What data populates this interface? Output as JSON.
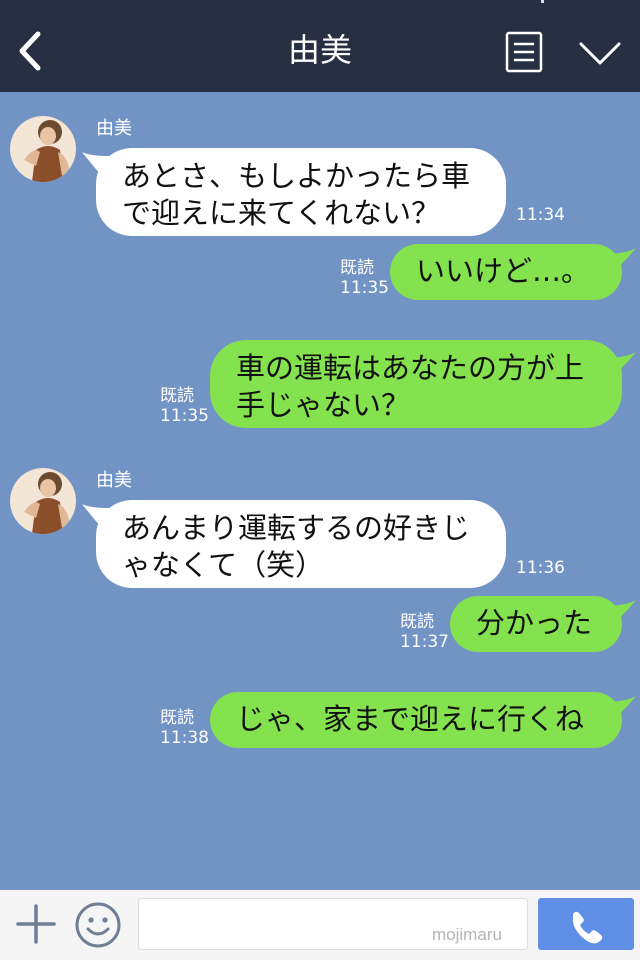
{
  "header": {
    "contact_name": "由美",
    "back_icon": "chevron-left-icon",
    "menu_icon": "list-icon",
    "collapse_icon": "chevron-down-icon"
  },
  "messages": [
    {
      "direction": "in",
      "sender": "由美",
      "lines": [
        "あとさ、もしよかったら車",
        "で迎えに来てくれない？"
      ],
      "time": "11:34"
    },
    {
      "direction": "out",
      "read_label": "既読",
      "lines": [
        "いいけど…。"
      ],
      "time": "11:35"
    },
    {
      "direction": "out",
      "read_label": "既読",
      "lines": [
        "車の運転はあなたの方が上",
        "手じゃない？"
      ],
      "time": "11:35"
    },
    {
      "direction": "in",
      "sender": "由美",
      "lines": [
        "あんまり運転するの好きじ",
        "ゃなくて（笑）"
      ],
      "time": "11:36"
    },
    {
      "direction": "out",
      "read_label": "既読",
      "lines": [
        "分かった"
      ],
      "time": "11:37"
    },
    {
      "direction": "out",
      "read_label": "既読",
      "lines": [
        "じゃ、家まで迎えに行くね"
      ],
      "time": "11:38"
    }
  ],
  "input_bar": {
    "plus_icon": "plus-icon",
    "emoji_icon": "smiley-icon",
    "message_value": "",
    "watermark": "mojimaru",
    "call_icon": "phone-icon"
  },
  "colors": {
    "header_bg": "#263042",
    "chat_bg": "#7294c4",
    "incoming_bubble": "#ffffff",
    "outgoing_bubble": "#84e24f",
    "call_button": "#5f8fe6"
  }
}
